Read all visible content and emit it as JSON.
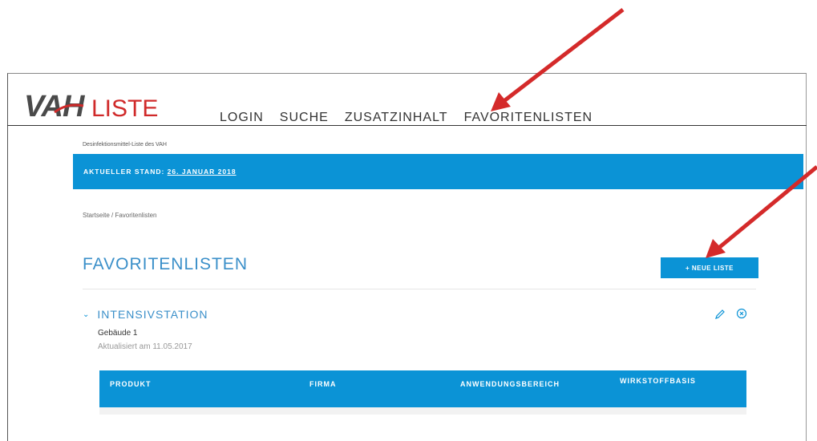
{
  "header": {
    "logo_vah": "VAH",
    "logo_liste": "LISTE",
    "nav": [
      "LOGIN",
      "SUCHE",
      "ZUSATZINHALT",
      "FAVORITENLISTEN"
    ],
    "tagline": "Desinfektionsmittel-Liste des VAH"
  },
  "banner": {
    "stand_label": "AKTUELLER STAND: ",
    "stand_date": "26. JANUAR 2018"
  },
  "breadcrumb": "Startseite / Favoritenlisten",
  "page_title": "FAVORITENLISTEN",
  "new_list_button": "+ NEUE LISTE",
  "list": {
    "name": "INTENSIVSTATION",
    "building": "Gebäude 1",
    "updated": "Aktualisiert am 11.05.2017",
    "columns": [
      "PRODUKT",
      "FIRMA",
      "ANWENDUNGSBEREICH",
      "WIRKSTOFFBASIS"
    ]
  },
  "colors": {
    "accent_blue": "#0b93d6",
    "title_blue": "#3a8fc9",
    "arrow_red": "#d42a2a"
  },
  "icons": [
    "chevron-down-icon",
    "pencil-icon",
    "close-circle-icon"
  ]
}
